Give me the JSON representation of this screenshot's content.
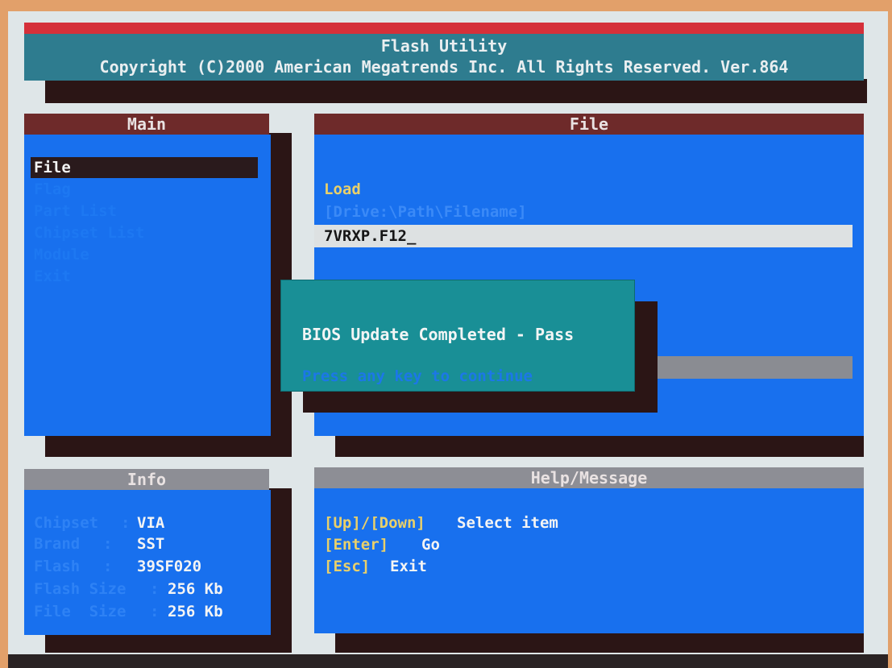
{
  "header": {
    "title": "Flash Utility",
    "copyright": "Copyright (C)2000 American Megatrends Inc. All Rights Reserved. Ver.864"
  },
  "main_panel": {
    "title": "Main",
    "items": [
      {
        "label": "File",
        "selected": true
      },
      {
        "label": "Flag",
        "selected": false
      },
      {
        "label": "Part List",
        "selected": false
      },
      {
        "label": "Chipset List",
        "selected": false
      },
      {
        "label": "Module",
        "selected": false
      },
      {
        "label": "Exit",
        "selected": false
      }
    ]
  },
  "file_panel": {
    "title": "File",
    "load_label": "Load",
    "path_hint": "[Drive:\\Path\\Filename]",
    "filename_value": "7VRXP.F12_"
  },
  "dialog": {
    "message": "BIOS Update Completed - Pass",
    "hint": "Press any key to continue"
  },
  "info_panel": {
    "title": "Info",
    "rows": [
      {
        "label": "Chipset",
        "sep": ":",
        "value": "VIA"
      },
      {
        "label": "Brand",
        "sep": ":",
        "value": "SST"
      },
      {
        "label": "Flash",
        "sep": ":",
        "value": "39SF020"
      },
      {
        "label": "Flash Size",
        "sep": ":",
        "value": "256 Kb"
      },
      {
        "label": "File  Size",
        "sep": ":",
        "value": "256 Kb"
      }
    ]
  },
  "help_panel": {
    "title": "Help/Message",
    "lines": [
      {
        "key": "[Up]/[Down]",
        "text": "Select item"
      },
      {
        "key": "[Enter]",
        "text": "Go"
      },
      {
        "key": "[Esc]",
        "text": "Exit"
      }
    ]
  },
  "colors": {
    "panel_blue": "#1870ee",
    "header_teal": "#2e7c8f",
    "dialog_teal": "#198f96",
    "title_red": "#6e2a2a",
    "title_gray": "#8d8e95",
    "label_yellow": "#e9d06a"
  }
}
